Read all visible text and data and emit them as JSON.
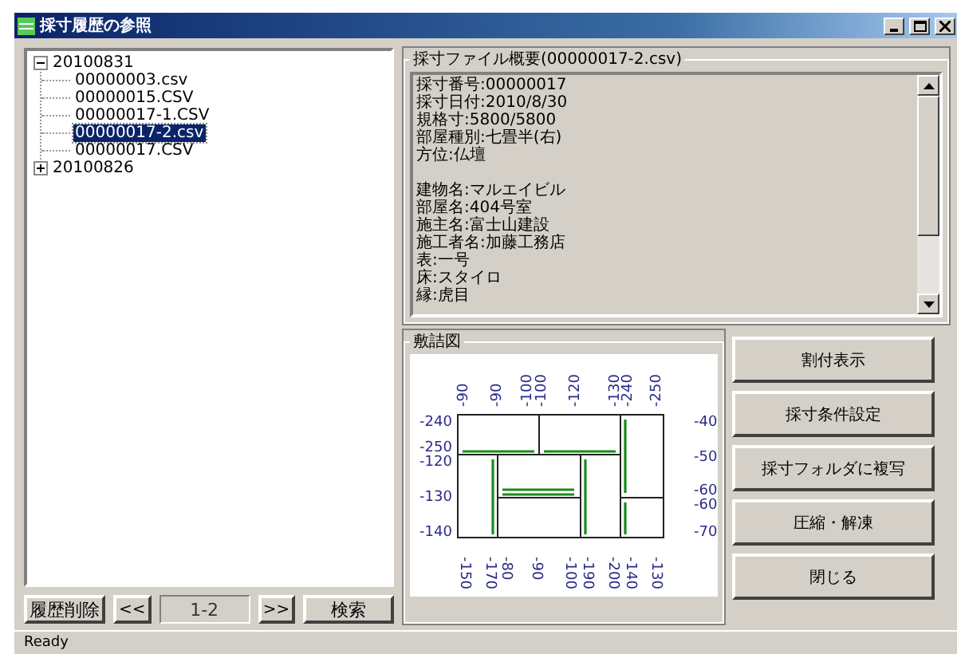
{
  "window": {
    "title": "採寸履歴の参照"
  },
  "tree": [
    {
      "label": "20100831",
      "expanded": true,
      "selected": false,
      "children": [
        {
          "label": "00000003.csv",
          "selected": false
        },
        {
          "label": "00000015.CSV",
          "selected": false
        },
        {
          "label": "00000017-1.CSV",
          "selected": false
        },
        {
          "label": "00000017-2.csv",
          "selected": true
        },
        {
          "label": "00000017.CSV",
          "selected": false
        }
      ]
    },
    {
      "label": "20100826",
      "expanded": false,
      "selected": false
    }
  ],
  "history_buttons": {
    "delete": "履歴削除",
    "prev": "<<",
    "page": "1-2",
    "next": ">>",
    "search": "検索"
  },
  "summary": {
    "title": "採寸ファイル概要(00000017-2.csv)",
    "sections": [
      [
        "採寸番号:00000017",
        "採寸日付:2010/8/30",
        "規格寸:5800/5800",
        "部屋種別:七畳半(右)",
        "方位:仏壇"
      ],
      [
        "建物名:マルエイビル",
        "部屋名:404号室",
        "施主名:富士山建設",
        "施工者名:加藤工務店",
        "表:一号",
        "床:スタイロ",
        "縁:虎目"
      ]
    ]
  },
  "layout": {
    "title": "敷詰図",
    "top_labels": [
      "-90",
      "-90",
      "-100",
      "-100",
      "-120",
      "-130",
      "-240",
      "-250"
    ],
    "bottom_labels": [
      "-150",
      "-170",
      "-80",
      "-90",
      "-100",
      "-190",
      "-200",
      "-140",
      "-130"
    ],
    "left_labels": [
      "-240",
      "-250",
      "-120",
      "-130",
      "-140"
    ],
    "right_labels": [
      "-40",
      "-50",
      "-60",
      "-60",
      "-70"
    ]
  },
  "actions": [
    "割付表示",
    "採寸条件設定",
    "採寸フォルダに複写",
    "圧縮・解凍",
    "閉じる"
  ],
  "status_bar": "Ready"
}
